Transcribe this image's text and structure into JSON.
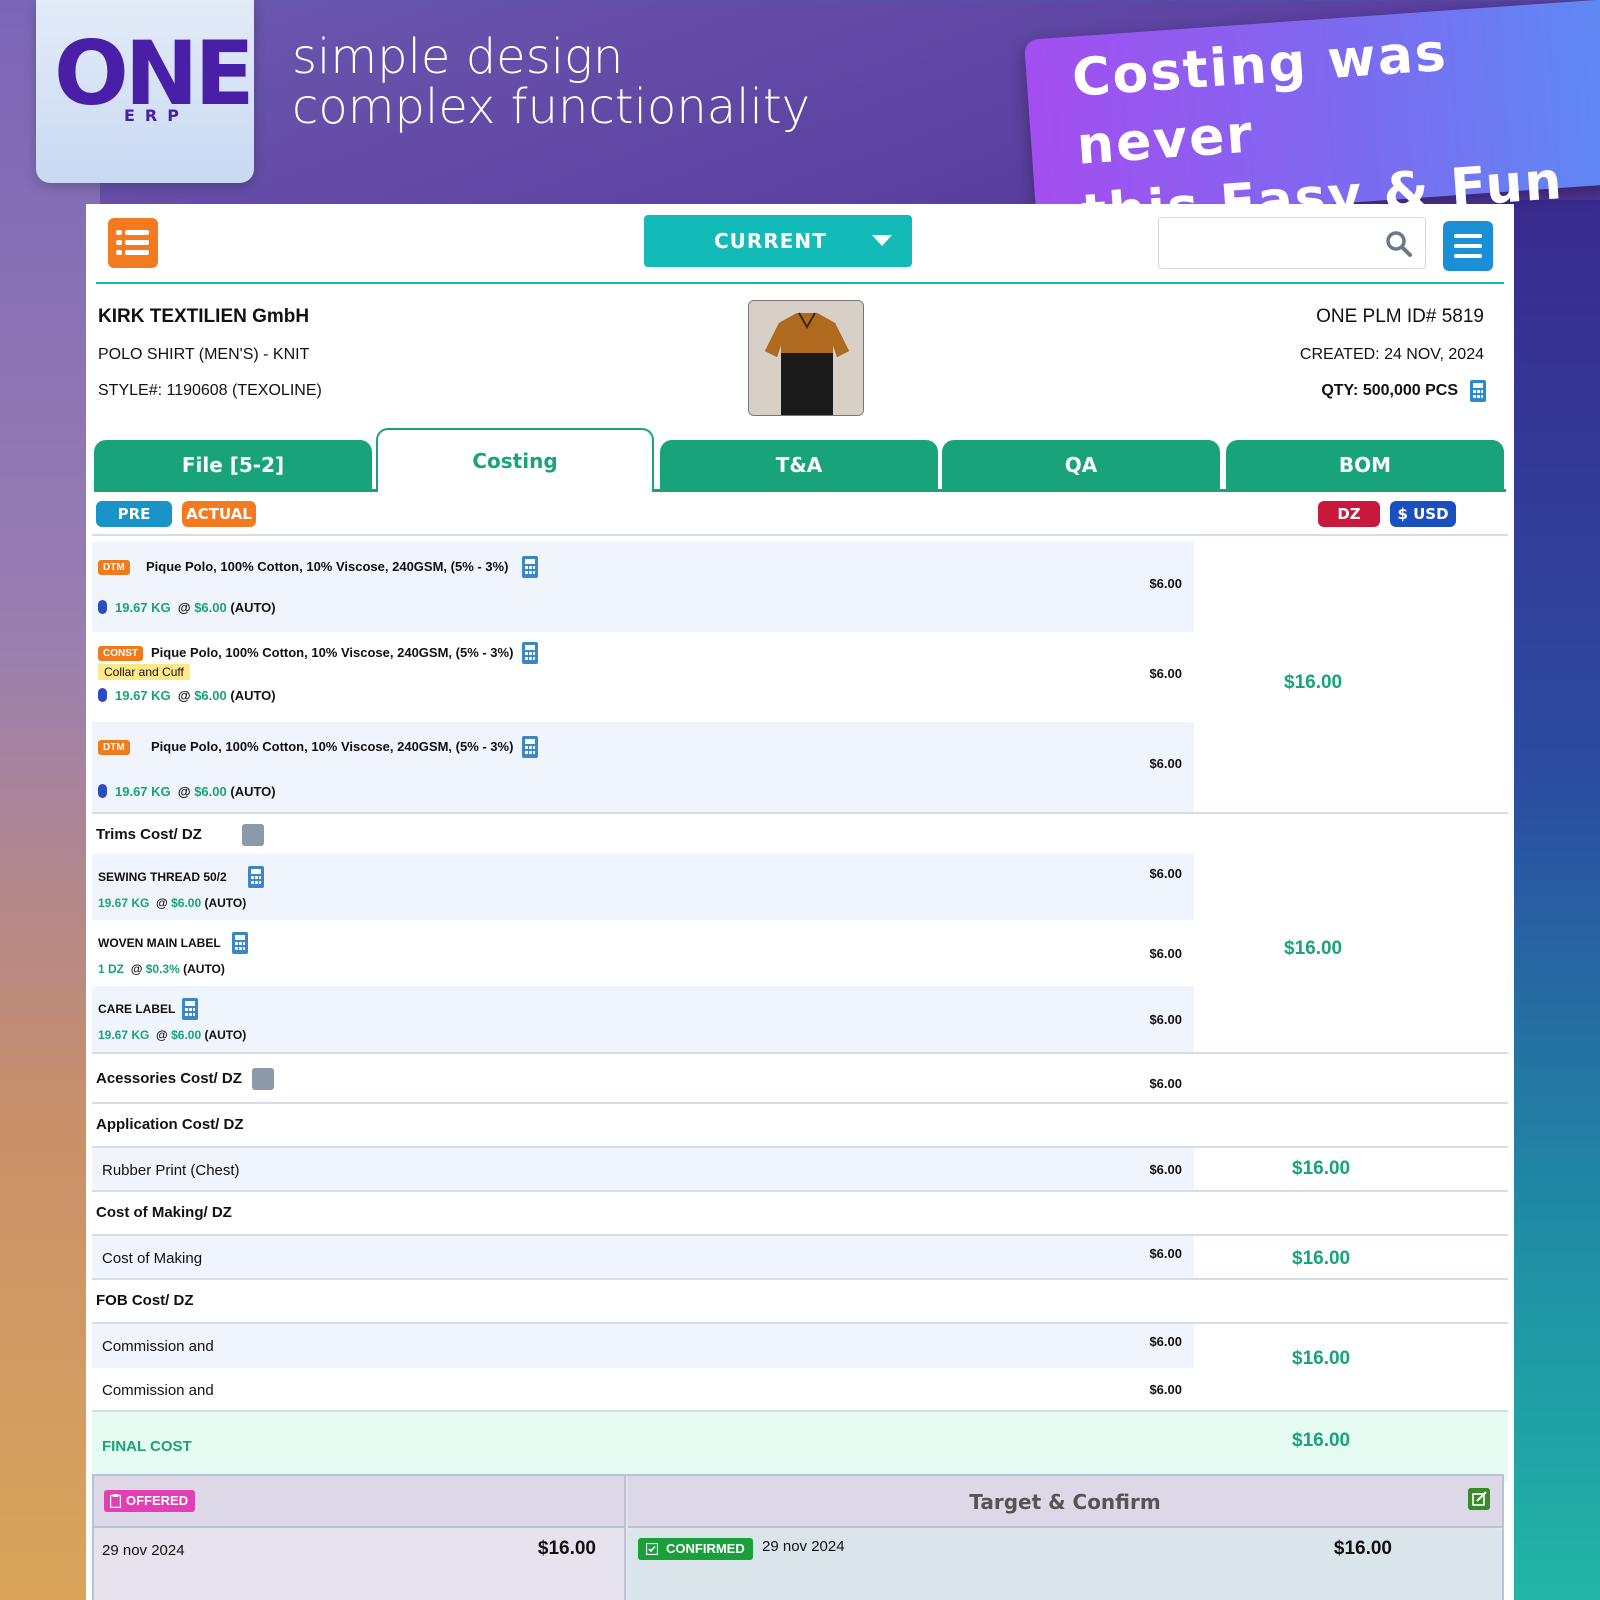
{
  "promo": {
    "logo_main": "ONE",
    "logo_sub": "ERP",
    "tagline_line1": "simple design",
    "tagline_line2": "complex functionality",
    "banner_line1": "Costing was never",
    "banner_line2": "this Easy & Fun"
  },
  "toolbar": {
    "version_select": "CURRENT",
    "search_placeholder": ""
  },
  "header": {
    "company": "KIRK TEXTILIEN GmbH",
    "product": "POLO SHIRT (MEN'S) - KNIT",
    "style": "STYLE#: 1190608 (TEXOLINE)",
    "plm_id": "ONE PLM ID# 5819",
    "created": "CREATED: 24 NOV, 2024",
    "qty_label": "QTY:",
    "qty_value": "500,000 PCS"
  },
  "tabs": [
    {
      "label": "File [5-2]",
      "active": false
    },
    {
      "label": "Costing",
      "active": true
    },
    {
      "label": "T&A",
      "active": false
    },
    {
      "label": "QA",
      "active": false
    },
    {
      "label": "BOM",
      "active": false
    }
  ],
  "filters": {
    "pre": "PRE",
    "actual": "ACTUAL",
    "unit": "DZ",
    "currency": "$ USD"
  },
  "fabrics": [
    {
      "badge": "DTM",
      "desc": "Pique Polo, 100% Cotton, 10% Viscose, 240GSM, (5% - 3%)",
      "note": "",
      "qty": "19.67 KG",
      "at": "@",
      "rate": "$6.00",
      "mode": "(AUTO)",
      "value": "$6.00"
    },
    {
      "badge": "CONST",
      "desc": "Pique Polo, 100% Cotton, 10% Viscose, 240GSM, (5% - 3%)",
      "note": "Collar and Cuff",
      "qty": "19.67 KG",
      "at": "@",
      "rate": "$6.00",
      "mode": "(AUTO)",
      "value": "$6.00"
    },
    {
      "badge": "DTM",
      "desc": "Pique Polo, 100% Cotton, 10% Viscose, 240GSM, (5% - 3%)",
      "note": "",
      "qty": "19.67 KG",
      "at": "@",
      "rate": "$6.00",
      "mode": "(AUTO)",
      "value": "$6.00"
    }
  ],
  "fabric_total": "$16.00",
  "trims": {
    "title": "Trims Cost/ DZ",
    "items": [
      {
        "name": "SEWING THREAD 50/2",
        "qty": "19.67 KG",
        "at": "@",
        "rate": "$6.00",
        "mode": "(AUTO)",
        "value": "$6.00"
      },
      {
        "name": "WOVEN MAIN LABEL",
        "qty": "1 DZ",
        "at": "@",
        "rate": "$0.3%",
        "mode": "(AUTO)",
        "value": "$6.00"
      },
      {
        "name": "CARE LABEL",
        "qty": "19.67 KG",
        "at": "@",
        "rate": "$6.00",
        "mode": "(AUTO)",
        "value": "$6.00"
      }
    ],
    "total": "$16.00"
  },
  "accessories": {
    "title": "Acessories Cost/ DZ",
    "value": "$6.00"
  },
  "application": {
    "title": "Application Cost/ DZ",
    "line": "Rubber Print (Chest)",
    "value": "$6.00",
    "total": "$16.00"
  },
  "making": {
    "title": "Cost of Making/ DZ",
    "line": "Cost of Making",
    "value": "$6.00",
    "total": "$16.00"
  },
  "fob": {
    "title": "FOB Cost/ DZ",
    "line1": "Commission and",
    "value1": "$6.00",
    "line2": "Commission and",
    "value2": "$6.00",
    "total": "$16.00"
  },
  "final": {
    "label": "FINAL COST",
    "value": "$16.00"
  },
  "bottom": {
    "offered": "OFFERED",
    "offered_date": "29 nov 2024",
    "offered_amount": "$16.00",
    "target_title": "Target & Confirm",
    "confirmed": "CONFIRMED",
    "confirmed_date": "29 nov 2024",
    "confirmed_amount": "$16.00"
  },
  "colors": {
    "accent_green": "#19a37a",
    "teal": "#12bbb8",
    "orange": "#f47a1f",
    "blue": "#1a8fd6",
    "red_pill": "#c8193c"
  }
}
